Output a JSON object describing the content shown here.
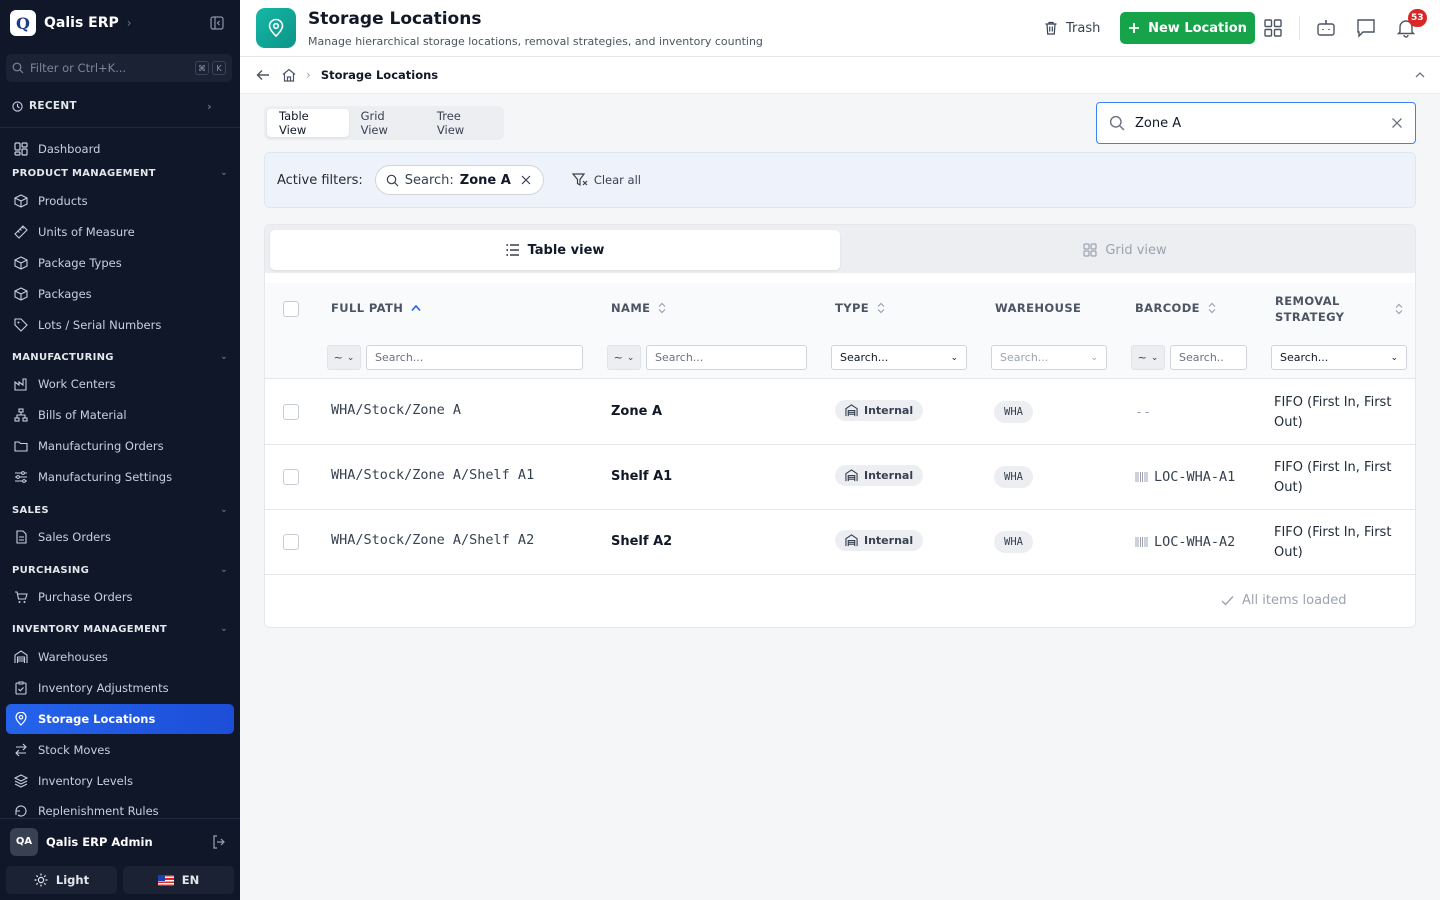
{
  "sidebar": {
    "app_name": "Qalis ERP",
    "logo_letter": "Q",
    "filter_placeholder": "Filter or Ctrl+K...",
    "kbd_keys": [
      "⌘",
      "K"
    ],
    "recent_label": "RECENT",
    "dashboard": "Dashboard",
    "sections": [
      {
        "title": "PRODUCT MANAGEMENT",
        "items": [
          "Products",
          "Units of Measure",
          "Package Types",
          "Packages",
          "Lots / Serial Numbers"
        ]
      },
      {
        "title": "MANUFACTURING",
        "items": [
          "Work Centers",
          "Bills of Material",
          "Manufacturing Orders",
          "Manufacturing Settings"
        ]
      },
      {
        "title": "SALES",
        "items": [
          "Sales Orders"
        ]
      },
      {
        "title": "PURCHASING",
        "items": [
          "Purchase Orders"
        ]
      },
      {
        "title": "INVENTORY MANAGEMENT",
        "items": [
          "Warehouses",
          "Inventory Adjustments",
          "Storage Locations",
          "Stock Moves",
          "Inventory Levels",
          "Replenishment Rules"
        ]
      }
    ],
    "active_item": "Storage Locations",
    "user": {
      "initials": "QA",
      "name": "Qalis ERP Admin"
    },
    "theme_label": "Light",
    "lang_label": "EN"
  },
  "header": {
    "title": "Storage Locations",
    "subtitle": "Manage hierarchical storage locations, removal strategies, and inventory counting",
    "trash_label": "Trash",
    "new_label": "New Location",
    "notification_count": "53"
  },
  "breadcrumb": {
    "current": "Storage Locations"
  },
  "view_tabs": [
    "Table View",
    "Grid View",
    "Tree View"
  ],
  "search": {
    "value": "Zone A"
  },
  "filters": {
    "label": "Active filters:",
    "chip_key": "Search:",
    "chip_value": "Zone A",
    "clear_all": "Clear all"
  },
  "segmented": {
    "table": "Table view",
    "grid": "Grid view"
  },
  "table": {
    "columns": [
      "FULL PATH",
      "NAME",
      "TYPE",
      "WAREHOUSE",
      "BARCODE",
      "REMOVAL STRATEGY"
    ],
    "removal_header_lines": [
      "REMOVAL",
      "STRATEGY"
    ],
    "op_label": "~",
    "search_placeholder": "Search...",
    "barcode_placeholder": "Search..",
    "rows": [
      {
        "path": "WHA/Stock/Zone A",
        "name": "Zone A",
        "type": "Internal",
        "warehouse": "WHA",
        "barcode": "--",
        "removal": "FIFO (First In, First Out)"
      },
      {
        "path": "WHA/Stock/Zone A/Shelf A1",
        "name": "Shelf A1",
        "type": "Internal",
        "warehouse": "WHA",
        "barcode": "LOC-WHA-A1",
        "removal": "FIFO (First In, First Out)"
      },
      {
        "path": "WHA/Stock/Zone A/Shelf A2",
        "name": "Shelf A2",
        "type": "Internal",
        "warehouse": "WHA",
        "barcode": "LOC-WHA-A2",
        "removal": "FIFO (First In, First Out)"
      }
    ],
    "footer": "All items loaded"
  },
  "colors": {
    "accent": "#2563eb",
    "primary_button": "#16a34a",
    "page_icon": "#14b8a6",
    "badge": "#dc2626"
  }
}
